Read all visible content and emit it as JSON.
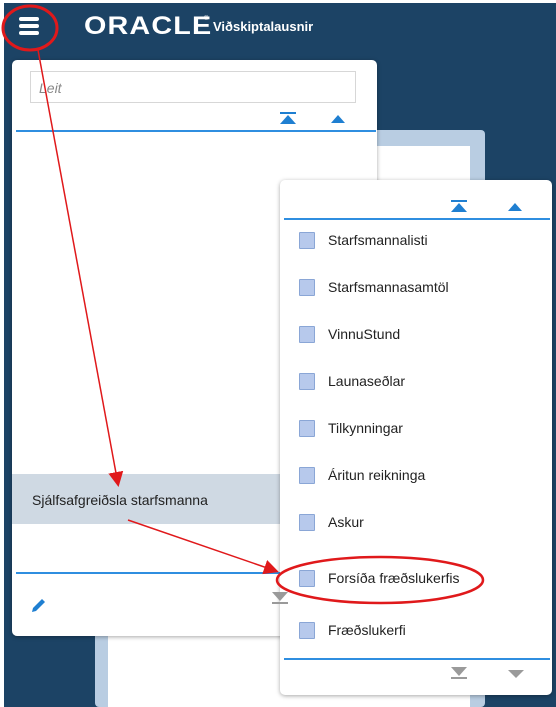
{
  "header": {
    "logo_text": "ORACLE",
    "logo_mark": "®",
    "app_name": "Viðskiptalausnir",
    "menu_icon": "hamburger-icon"
  },
  "left_menu": {
    "search_placeholder": "Leit",
    "selected_item": "Sjálfsafgreiðsla starfsmanna",
    "edit_icon": "pencil-icon"
  },
  "submenu": {
    "items": [
      {
        "label": "Starfsmannalisti",
        "icon": "document-icon"
      },
      {
        "label": "Starfsmannasamtöl",
        "icon": "document-icon"
      },
      {
        "label": "VinnuStund",
        "icon": "document-icon"
      },
      {
        "label": "Launaseðlar",
        "icon": "document-icon"
      },
      {
        "label": "Tilkynningar",
        "icon": "document-icon"
      },
      {
        "label": "Áritun reikninga",
        "icon": "document-icon"
      },
      {
        "label": "Askur",
        "icon": "document-icon"
      },
      {
        "label": "Forsíða fræðslukerfis",
        "icon": "document-icon"
      },
      {
        "label": "Fræðslukerfi",
        "icon": "document-icon"
      }
    ]
  },
  "colors": {
    "navy": "#1c4365",
    "accent": "#1f7fd1",
    "annotation": "#e0191b"
  }
}
